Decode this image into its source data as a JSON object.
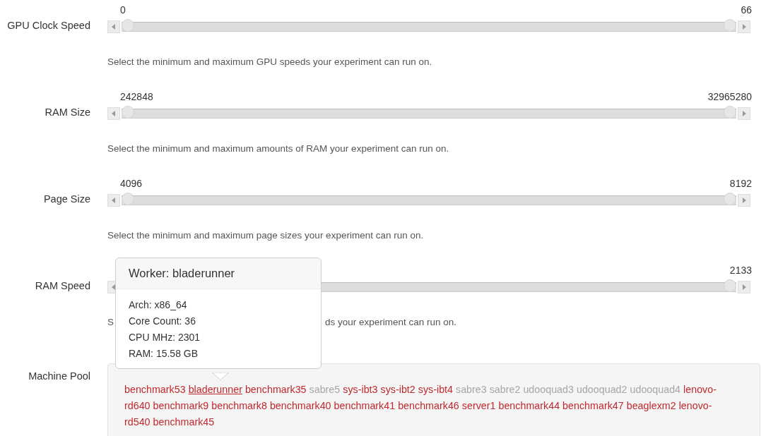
{
  "sliders": [
    {
      "label": "GPU Clock Speed",
      "min_value": "0",
      "max_value": "66",
      "thumbs": [
        {
          "level": 0
        },
        {
          "level": 1
        }
      ],
      "description": [
        "Select the minimum and maximum GPU speeds your experiment can run on."
      ]
    },
    {
      "label": "RAM Size",
      "min_value": "242848",
      "max_value": "32965280",
      "thumbs": [
        {
          "level": 0
        },
        {
          "level": 1
        }
      ],
      "description": [
        "Select the minimum and maximum amounts of RAM your experiment can run on."
      ]
    },
    {
      "label": "Page Size",
      "min_value": "4096",
      "max_value": "8192",
      "thumbs": [
        {
          "level": 0
        },
        {
          "level": 1
        }
      ],
      "description": [
        "Select the minimum and maximum page sizes your experiment can run on."
      ]
    },
    {
      "label": "RAM Speed",
      "max_value": "2133",
      "thumbs": [
        {
          "level": 1
        }
      ],
      "description": [
        "S",
        "ds your experiment can run on."
      ]
    }
  ],
  "machine_pool": {
    "label": "Machine Pool",
    "machines": [
      {
        "name": "benchmark53",
        "available": true,
        "hovered": false
      },
      {
        "name": "bladerunner",
        "available": true,
        "hovered": true
      },
      {
        "name": "benchmark35",
        "available": true,
        "hovered": false
      },
      {
        "name": "sabre5",
        "available": false,
        "hovered": false
      },
      {
        "name": "sys-ibt3",
        "available": true,
        "hovered": false
      },
      {
        "name": "sys-ibt2",
        "available": true,
        "hovered": false
      },
      {
        "name": "sys-ibt4",
        "available": true,
        "hovered": false
      },
      {
        "name": "sabre3",
        "available": false,
        "hovered": false
      },
      {
        "name": "sabre2",
        "available": false,
        "hovered": false
      },
      {
        "name": "udooquad3",
        "available": false,
        "hovered": false
      },
      {
        "name": "udooquad2",
        "available": false,
        "hovered": false
      },
      {
        "name": "udooquad4",
        "available": false,
        "hovered": false
      },
      {
        "name": [
          "lenovo-",
          "rd640"
        ],
        "available": true,
        "hovered": false
      },
      {
        "name": "benchmark9",
        "available": true,
        "hovered": false
      },
      {
        "name": "benchmark8",
        "available": true,
        "hovered": false
      },
      {
        "name": "benchmark40",
        "available": true,
        "hovered": false
      },
      {
        "name": "benchmark41",
        "available": true,
        "hovered": false
      },
      {
        "name": "benchmark46",
        "available": true,
        "hovered": false
      },
      {
        "name": "server1",
        "available": true,
        "hovered": false
      },
      {
        "name": "benchmark44",
        "available": true,
        "hovered": false
      },
      {
        "name": "benchmark47",
        "available": true,
        "hovered": false
      },
      {
        "name": "beaglexm2",
        "available": true,
        "hovered": false
      },
      {
        "name": [
          "lenovo-",
          "rd540"
        ],
        "available": true,
        "hovered": false
      },
      {
        "name": "benchmark45",
        "available": true,
        "hovered": false
      }
    ]
  },
  "tooltip": {
    "title": "Worker: bladerunner",
    "lines": [
      "Arch: x86_64",
      "Core Count: 36",
      "CPU MHz: 2301",
      "RAM: 15.58 GB"
    ]
  }
}
